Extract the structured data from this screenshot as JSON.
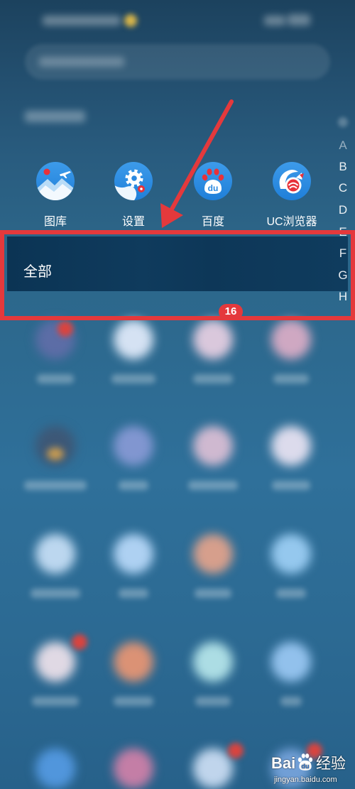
{
  "apps": [
    {
      "label": "图库",
      "icon": "gallery-icon"
    },
    {
      "label": "设置",
      "icon": "settings-icon"
    },
    {
      "label": "百度",
      "icon": "baidu-icon",
      "logo_text": "du"
    },
    {
      "label": "UC浏览器",
      "icon": "uc-browser-icon"
    }
  ],
  "category_menu": {
    "selected_label": "全部"
  },
  "notification_badge": {
    "count": 16
  },
  "alphabet_index": [
    "A",
    "B",
    "C",
    "D",
    "E",
    "F",
    "G",
    "H"
  ],
  "annotation": {
    "color": "#e4393c"
  },
  "colors": {
    "background": "#2c6588",
    "menu_band": "#0e3a5c",
    "app_icon_blue": "#2f8ee3",
    "badge_red": "#e4393c",
    "text": "#ffffff"
  },
  "watermark": {
    "brand_text": "Bai",
    "logo_text": "du",
    "product_text": "经验",
    "url": "jingyan.baidu.com"
  }
}
